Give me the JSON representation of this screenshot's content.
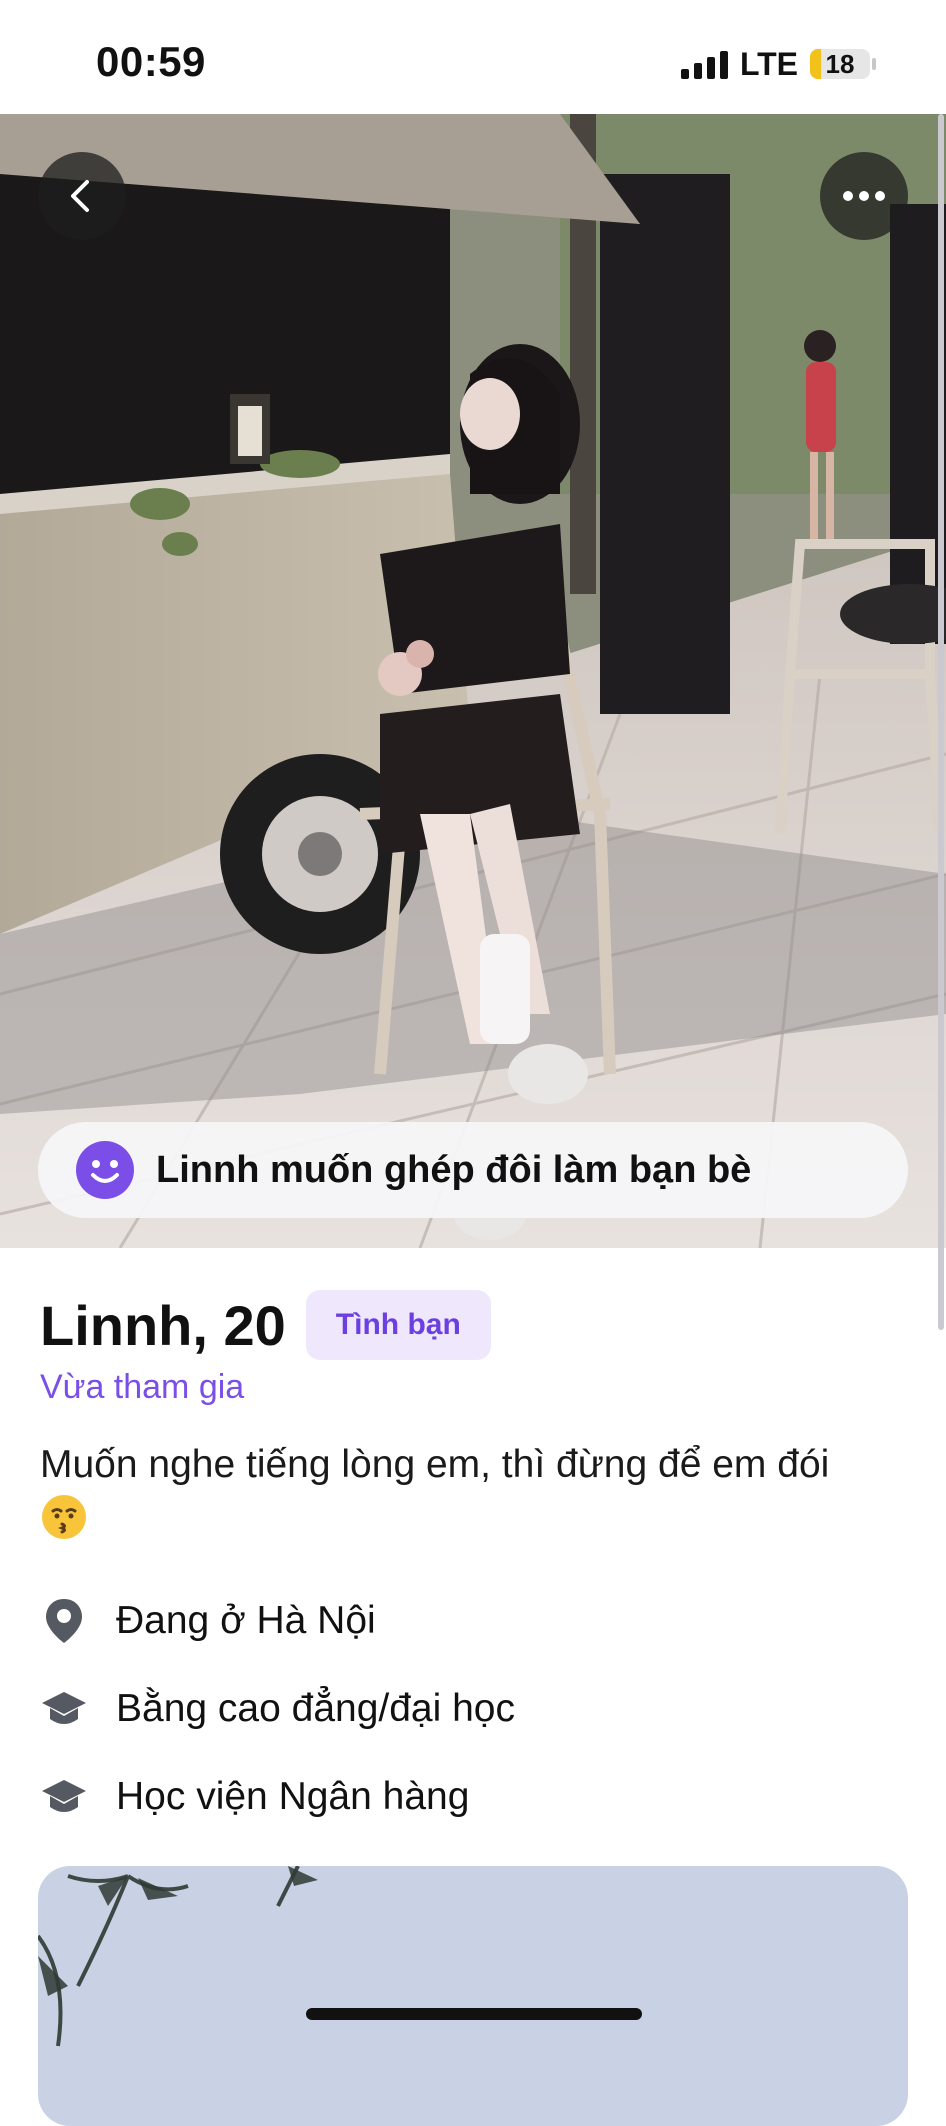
{
  "status_bar": {
    "time": "00:59",
    "network": "LTE",
    "battery_level": "18",
    "battery_fraction": 0.18
  },
  "header": {
    "back_icon": "chevron-left-icon",
    "more_icon": "more-horizontal-icon"
  },
  "match_banner": {
    "icon": "smile-icon",
    "text": "Linnh muốn ghép đôi làm bạn bè",
    "icon_color": "#7c4ee8"
  },
  "profile": {
    "name_age": "Linnh, 20",
    "tag": "Tình bạn",
    "status": "Vừa tham gia",
    "bio": "Muốn nghe tiếng lòng em, thì đừng để em đói",
    "bio_emoji": "kissing-face-emoji",
    "accent_color": "#7a4fe8",
    "tag_background": "#efe8fd",
    "info": [
      {
        "icon": "location-pin-icon",
        "label": "Đang ở Hà Nội"
      },
      {
        "icon": "graduation-cap-icon",
        "label": "Bằng cao đẳng/đại học"
      },
      {
        "icon": "graduation-cap-icon",
        "label": "Học viện Ngân hàng"
      }
    ]
  }
}
